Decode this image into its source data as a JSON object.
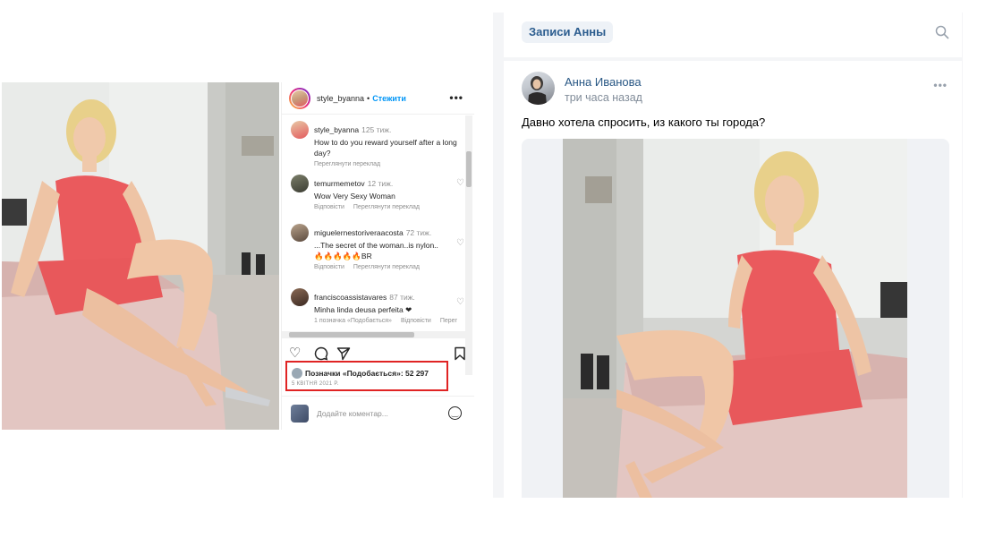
{
  "instagram": {
    "username": "style_byanna",
    "separator": "•",
    "follow_label": "Стежити",
    "more_label": "•••",
    "comments": [
      {
        "user": "style_byanna",
        "time": "125 тиж.",
        "text": "How to do you reward yourself after a long day?",
        "actions": [
          "Переглянути переклад"
        ]
      },
      {
        "user": "temurmemetov",
        "time": "12 тиж.",
        "text": "Wow Very Sexy Woman",
        "actions": [
          "Відповісти",
          "Переглянути переклад"
        ]
      },
      {
        "user": "miguelernestoriveraacosta",
        "time": "72 тиж.",
        "text": "...The secret of the woman..is nylon..",
        "text2": "🔥🔥🔥🔥🔥BR",
        "actions": [
          "Відповісти",
          "Переглянути переклад"
        ]
      },
      {
        "user": "franciscoassistavares",
        "time": "87 тиж.",
        "text": "Minha linda deusa perfeita ❤",
        "actions": [
          "1 позначка «Подобається»",
          "Відповісти",
          "Перег"
        ]
      }
    ],
    "likes_text": "Позначки «Подобається»: 52 297",
    "date": "5 КВІТНЯ 2021 Р.",
    "comment_placeholder": "Додайте коментар..."
  },
  "vk": {
    "tab_label": "Записи Анны",
    "author": "Анна Иванова",
    "time": "три часа назад",
    "more_label": "•••",
    "post_text": "Давно хотела спросить, из какого ты города?"
  }
}
